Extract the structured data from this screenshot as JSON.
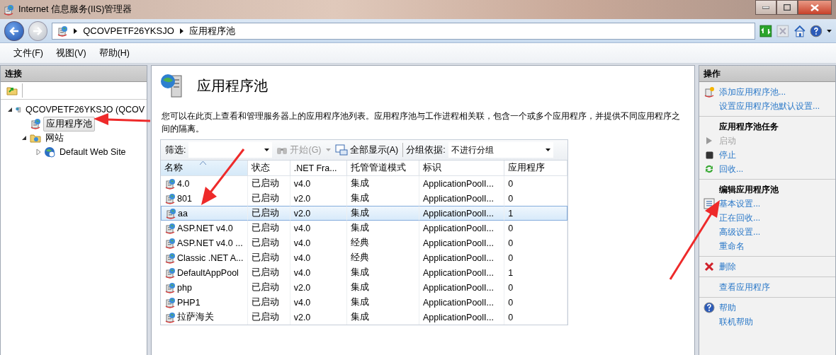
{
  "window": {
    "title": "Internet 信息服务(IIS)管理器"
  },
  "address": {
    "segments": [
      "QCOVPETF26YKSJO",
      "应用程序池"
    ]
  },
  "menu": [
    "文件(F)",
    "视图(V)",
    "帮助(H)"
  ],
  "connections": {
    "title": "连接",
    "tree": [
      {
        "label": "QCOVPETF26YKSJO (QCOV",
        "kind": "server",
        "expanded": true,
        "selected": false,
        "children": [
          {
            "label": "应用程序池",
            "kind": "pools",
            "selected": true
          },
          {
            "label": "网站",
            "kind": "folder",
            "expanded": true,
            "selected": false,
            "children": [
              {
                "label": "Default Web Site",
                "kind": "globe",
                "expanded": false,
                "selected": false
              }
            ]
          }
        ]
      }
    ]
  },
  "main": {
    "title": "应用程序池",
    "description": "您可以在此页上查看和管理服务器上的应用程序池列表。应用程序池与工作进程相关联，包含一个或多个应用程序，并提供不同应用程序之间的隔离。",
    "toolbar": {
      "filter_label": "筛选:",
      "start": "开始(G)",
      "show_all": "全部显示(A)",
      "group_label": "分组依据:",
      "group_value": "不进行分组"
    },
    "table": {
      "columns": [
        {
          "label": "名称",
          "sorted": true
        },
        {
          "label": "状态",
          "sorted": false
        },
        {
          "label": ".NET Fra...",
          "sorted": false
        },
        {
          "label": "托管管道模式",
          "sorted": false
        },
        {
          "label": "标识",
          "sorted": false
        },
        {
          "label": "应用程序",
          "sorted": false
        }
      ],
      "rows": [
        {
          "cells": [
            "4.0",
            "已启动",
            "v4.0",
            "集成",
            "ApplicationPoolI...",
            "0"
          ],
          "selected": false
        },
        {
          "cells": [
            "801",
            "已启动",
            "v2.0",
            "集成",
            "ApplicationPoolI...",
            "0"
          ],
          "selected": false
        },
        {
          "cells": [
            "aa",
            "已启动",
            "v2.0",
            "集成",
            "ApplicationPoolI...",
            "1"
          ],
          "selected": true
        },
        {
          "cells": [
            "ASP.NET v4.0",
            "已启动",
            "v4.0",
            "集成",
            "ApplicationPoolI...",
            "0"
          ],
          "selected": false
        },
        {
          "cells": [
            "ASP.NET v4.0 ...",
            "已启动",
            "v4.0",
            "经典",
            "ApplicationPoolI...",
            "0"
          ],
          "selected": false
        },
        {
          "cells": [
            "Classic .NET A...",
            "已启动",
            "v4.0",
            "经典",
            "ApplicationPoolI...",
            "0"
          ],
          "selected": false
        },
        {
          "cells": [
            "DefaultAppPool",
            "已启动",
            "v4.0",
            "集成",
            "ApplicationPoolI...",
            "1"
          ],
          "selected": false
        },
        {
          "cells": [
            "php",
            "已启动",
            "v2.0",
            "集成",
            "ApplicationPoolI...",
            "0"
          ],
          "selected": false
        },
        {
          "cells": [
            "PHP1",
            "已启动",
            "v4.0",
            "集成",
            "ApplicationPoolI...",
            "0"
          ],
          "selected": false
        },
        {
          "cells": [
            "拉萨海关",
            "已启动",
            "v2.0",
            "集成",
            "ApplicationPoolI...",
            "0"
          ],
          "selected": false
        }
      ]
    }
  },
  "actions": {
    "title": "操作",
    "groups": [
      {
        "items": [
          {
            "kind": "add",
            "label": "添加应用程序池...",
            "disabled": false
          },
          {
            "kind": "link",
            "label": "设置应用程序池默认设置...",
            "disabled": false
          }
        ]
      },
      {
        "items": [
          {
            "kind": "header",
            "label": "应用程序池任务"
          },
          {
            "kind": "start",
            "label": "启动",
            "disabled": true
          },
          {
            "kind": "stop",
            "label": "停止",
            "disabled": false
          },
          {
            "kind": "recycle",
            "label": "回收...",
            "disabled": false
          }
        ]
      },
      {
        "items": [
          {
            "kind": "header",
            "label": "编辑应用程序池"
          },
          {
            "kind": "settings",
            "label": "基本设置...",
            "disabled": false
          },
          {
            "kind": "link",
            "label": "正在回收...",
            "disabled": false
          },
          {
            "kind": "link",
            "label": "高级设置...",
            "disabled": false
          },
          {
            "kind": "link",
            "label": "重命名",
            "disabled": false
          }
        ]
      },
      {
        "items": [
          {
            "kind": "delete",
            "label": "删除",
            "disabled": false
          }
        ]
      },
      {
        "items": [
          {
            "kind": "link",
            "label": "查看应用程序",
            "disabled": false
          }
        ]
      },
      {
        "items": [
          {
            "kind": "help",
            "label": "帮助",
            "disabled": false
          },
          {
            "kind": "link",
            "label": "联机帮助",
            "disabled": false
          }
        ]
      }
    ]
  }
}
